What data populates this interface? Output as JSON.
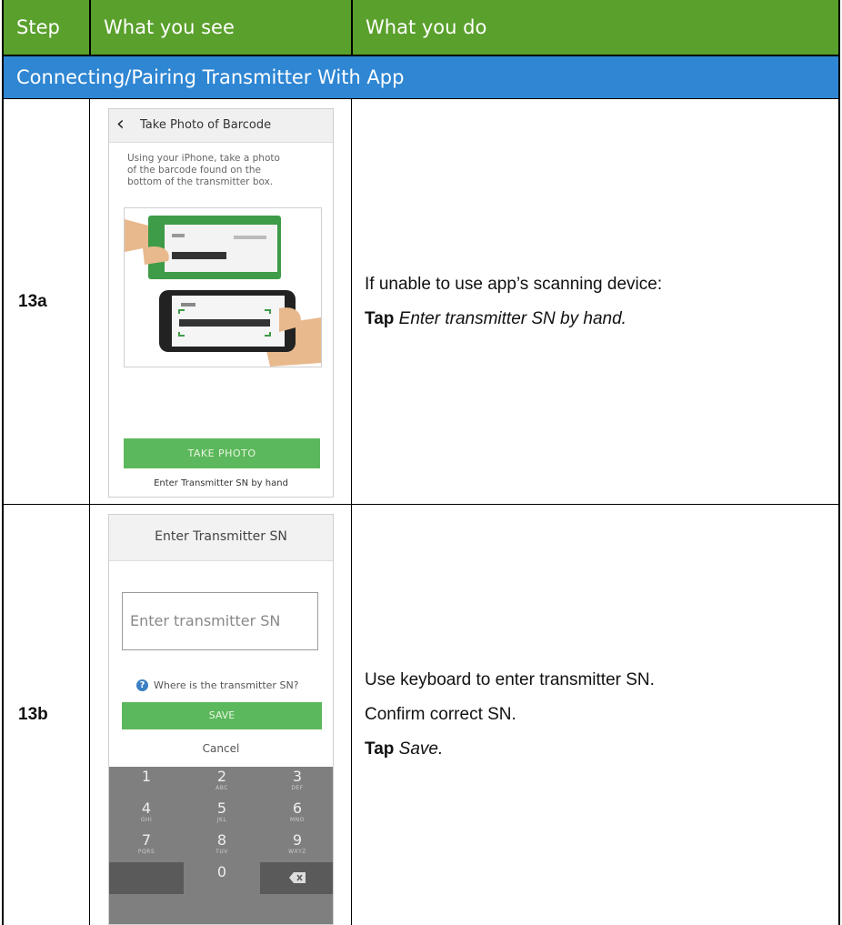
{
  "header": {
    "step": "Step",
    "what_you_see": "What you see",
    "what_you_do": "What you do"
  },
  "section_title": "Connecting/Pairing Transmitter With App",
  "colors": {
    "header_green": "#5aa02c",
    "section_blue": "#2f86d3",
    "app_button_green": "#5cb85c",
    "keypad_gray": "#7f7f7f"
  },
  "rows": [
    {
      "step": "13a",
      "screen": {
        "back_icon": "chevron-left-icon",
        "title": "Take Photo of Barcode",
        "instruction": "Using your iPhone, take a photo of the barcode found on the bottom of the transmitter box.",
        "button": "TAKE PHOTO",
        "link": "Enter Transmitter SN by hand"
      },
      "instructions": {
        "line1": "If unable to use app’s scanning device:",
        "line2_bold": "Tap",
        "line2_italic": "Enter transmitter SN by hand."
      }
    },
    {
      "step": "13b",
      "screen": {
        "title": "Enter Transmitter SN",
        "input_placeholder": "Enter transmitter SN",
        "help_icon": "question-circle-icon",
        "help_text": "Where is the transmitter SN?",
        "button": "SAVE",
        "cancel": "Cancel",
        "keys": [
          {
            "num": "1",
            "sub": ""
          },
          {
            "num": "2",
            "sub": "ABC"
          },
          {
            "num": "3",
            "sub": "DEF"
          },
          {
            "num": "4",
            "sub": "GHI"
          },
          {
            "num": "5",
            "sub": "JKL"
          },
          {
            "num": "6",
            "sub": "MNO"
          },
          {
            "num": "7",
            "sub": "PQRS"
          },
          {
            "num": "8",
            "sub": "TUV"
          },
          {
            "num": "9",
            "sub": "WXYZ"
          },
          {
            "num": "0",
            "sub": ""
          }
        ],
        "delete_icon": "backspace-icon"
      },
      "instructions": {
        "line1": "Use keyboard to enter transmitter SN.",
        "line2": "Confirm correct SN.",
        "line3_bold": "Tap",
        "line3_italic": "Save."
      }
    }
  ]
}
